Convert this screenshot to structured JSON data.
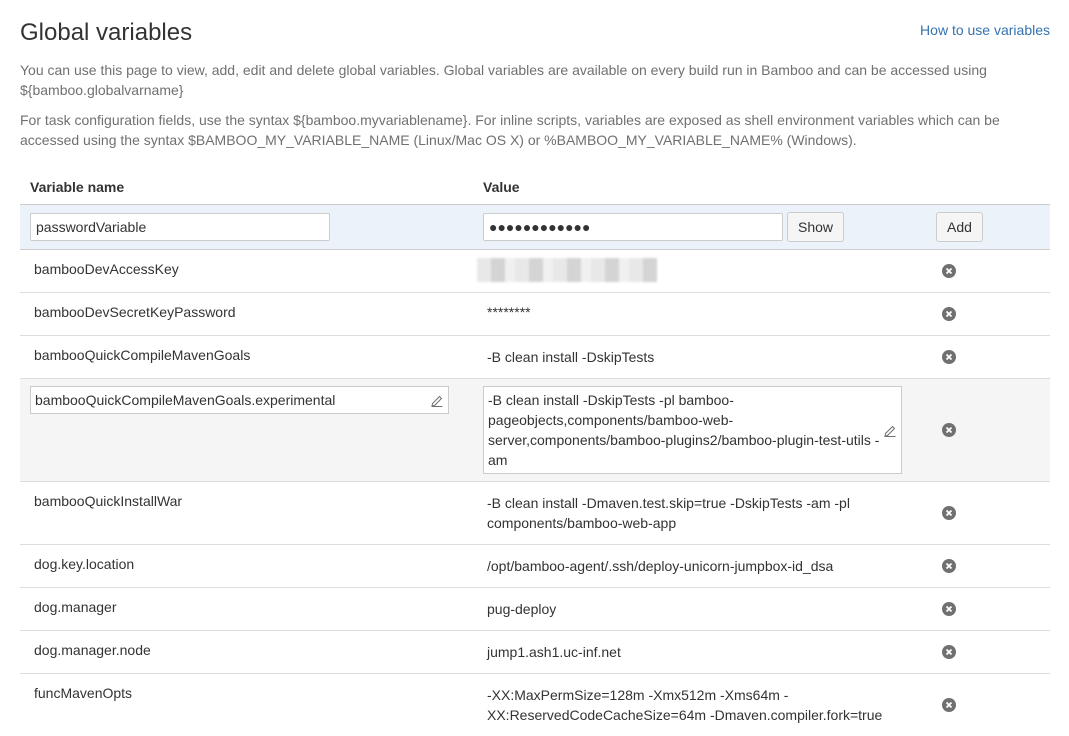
{
  "header": {
    "title": "Global variables",
    "help_link": "How to use variables"
  },
  "description": {
    "para1": "You can use this page to view, add, edit and delete global variables. Global variables are available on every build run in Bamboo and can be accessed using ${bamboo.globalvarname}",
    "para2": "For task configuration fields, use the syntax ${bamboo.myvariablename}. For inline scripts, variables are exposed as shell environment variables which can be accessed using the syntax $BAMBOO_MY_VARIABLE_NAME (Linux/Mac OS X) or %BAMBOO_MY_VARIABLE_NAME% (Windows)."
  },
  "table": {
    "col_name": "Variable name",
    "col_value": "Value"
  },
  "add_form": {
    "name_value": "passwordVariable",
    "password_value": "●●●●●●●●●●●●",
    "show_label": "Show",
    "add_label": "Add"
  },
  "rows": [
    {
      "name": "bambooDevAccessKey",
      "value": ""
    },
    {
      "name": "bambooDevSecretKeyPassword",
      "value": "********"
    },
    {
      "name": "bambooQuickCompileMavenGoals",
      "value": "-B clean install -DskipTests"
    },
    {
      "name": "bambooQuickCompileMavenGoals.experimental",
      "value_lines": [
        "-B clean install -DskipTests -pl bamboo-",
        "pageobjects,components/bamboo-web-",
        "server,components/bamboo-plugins2/bamboo-plugin-test-utils -",
        "am"
      ]
    },
    {
      "name": "bambooQuickInstallWar",
      "value_lines": [
        "-B clean install -Dmaven.test.skip=true -DskipTests -am -pl",
        "components/bamboo-web-app"
      ]
    },
    {
      "name": "dog.key.location",
      "value": "/opt/bamboo-agent/.ssh/deploy-unicorn-jumpbox-id_dsa"
    },
    {
      "name": "dog.manager",
      "value": "pug-deploy"
    },
    {
      "name": "dog.manager.node",
      "value": "jump1.ash1.uc-inf.net"
    },
    {
      "name": "funcMavenOpts",
      "value_lines": [
        "-XX:MaxPermSize=128m -Xmx512m -Xms64m -",
        "XX:ReservedCodeCacheSize=64m -Dmaven.compiler.fork=true"
      ]
    }
  ],
  "colors": {
    "link": "#3572b0",
    "add_row_bg": "#ebf2f9",
    "edit_row_bg": "#f5f5f5"
  },
  "icons": {
    "delete": "delete-icon",
    "edit": "pencil-icon"
  }
}
